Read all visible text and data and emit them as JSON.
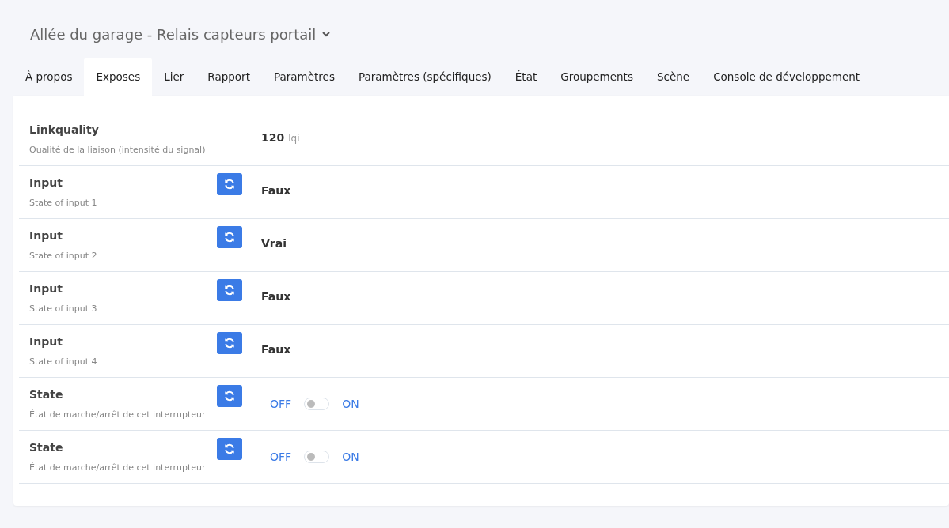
{
  "header": {
    "title": "Allée du garage - Relais capteurs portail"
  },
  "tabs": [
    {
      "label": "À propos",
      "selected": false
    },
    {
      "label": "Exposes",
      "selected": true
    },
    {
      "label": "Lier",
      "selected": false
    },
    {
      "label": "Rapport",
      "selected": false
    },
    {
      "label": "Paramètres",
      "selected": false
    },
    {
      "label": "Paramètres (spécifiques)",
      "selected": false
    },
    {
      "label": "État",
      "selected": false
    },
    {
      "label": "Groupements",
      "selected": false
    },
    {
      "label": "Scène",
      "selected": false
    },
    {
      "label": "Console de développement",
      "selected": false
    }
  ],
  "exposes": [
    {
      "kind": "numeric",
      "name": "Linkquality",
      "description": "Qualité de la liaison (intensité du signal)",
      "refreshable": false,
      "value": "120",
      "unit": "lqi"
    },
    {
      "kind": "binary",
      "name": "Input",
      "description": "State of input 1",
      "refreshable": true,
      "value": "Faux"
    },
    {
      "kind": "binary",
      "name": "Input",
      "description": "State of input 2",
      "refreshable": true,
      "value": "Vrai"
    },
    {
      "kind": "binary",
      "name": "Input",
      "description": "State of input 3",
      "refreshable": true,
      "value": "Faux"
    },
    {
      "kind": "binary",
      "name": "Input",
      "description": "State of input 4",
      "refreshable": true,
      "value": "Faux"
    },
    {
      "kind": "switch",
      "name": "State",
      "description": "État de marche/arrêt de cet interrupteur",
      "refreshable": true,
      "off_label": "OFF",
      "on_label": "ON",
      "on": false
    },
    {
      "kind": "switch",
      "name": "State",
      "description": "État de marche/arrêt de cet interrupteur",
      "refreshable": true,
      "off_label": "OFF",
      "on_label": "ON",
      "on": false
    }
  ]
}
